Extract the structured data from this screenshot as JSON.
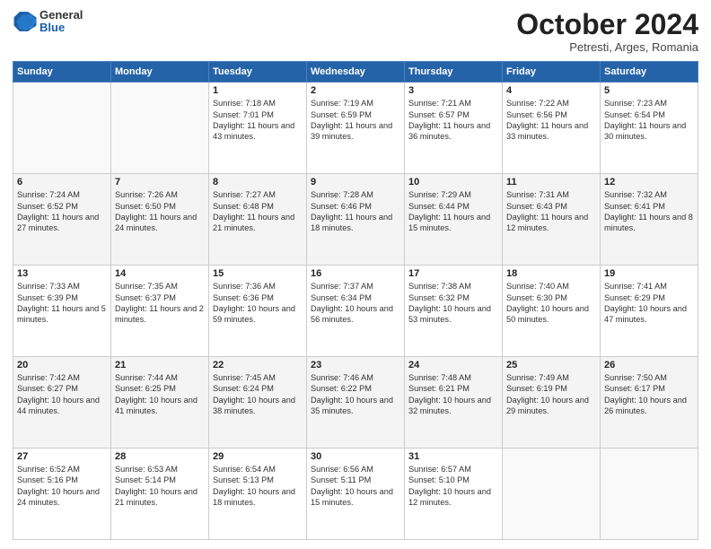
{
  "header": {
    "logo_general": "General",
    "logo_blue": "Blue",
    "month": "October 2024",
    "location": "Petresti, Arges, Romania"
  },
  "days_of_week": [
    "Sunday",
    "Monday",
    "Tuesday",
    "Wednesday",
    "Thursday",
    "Friday",
    "Saturday"
  ],
  "weeks": [
    [
      {
        "day": null,
        "content": ""
      },
      {
        "day": null,
        "content": ""
      },
      {
        "day": "1",
        "content": "Sunrise: 7:18 AM\nSunset: 7:01 PM\nDaylight: 11 hours and 43 minutes."
      },
      {
        "day": "2",
        "content": "Sunrise: 7:19 AM\nSunset: 6:59 PM\nDaylight: 11 hours and 39 minutes."
      },
      {
        "day": "3",
        "content": "Sunrise: 7:21 AM\nSunset: 6:57 PM\nDaylight: 11 hours and 36 minutes."
      },
      {
        "day": "4",
        "content": "Sunrise: 7:22 AM\nSunset: 6:56 PM\nDaylight: 11 hours and 33 minutes."
      },
      {
        "day": "5",
        "content": "Sunrise: 7:23 AM\nSunset: 6:54 PM\nDaylight: 11 hours and 30 minutes."
      }
    ],
    [
      {
        "day": "6",
        "content": "Sunrise: 7:24 AM\nSunset: 6:52 PM\nDaylight: 11 hours and 27 minutes."
      },
      {
        "day": "7",
        "content": "Sunrise: 7:26 AM\nSunset: 6:50 PM\nDaylight: 11 hours and 24 minutes."
      },
      {
        "day": "8",
        "content": "Sunrise: 7:27 AM\nSunset: 6:48 PM\nDaylight: 11 hours and 21 minutes."
      },
      {
        "day": "9",
        "content": "Sunrise: 7:28 AM\nSunset: 6:46 PM\nDaylight: 11 hours and 18 minutes."
      },
      {
        "day": "10",
        "content": "Sunrise: 7:29 AM\nSunset: 6:44 PM\nDaylight: 11 hours and 15 minutes."
      },
      {
        "day": "11",
        "content": "Sunrise: 7:31 AM\nSunset: 6:43 PM\nDaylight: 11 hours and 12 minutes."
      },
      {
        "day": "12",
        "content": "Sunrise: 7:32 AM\nSunset: 6:41 PM\nDaylight: 11 hours and 8 minutes."
      }
    ],
    [
      {
        "day": "13",
        "content": "Sunrise: 7:33 AM\nSunset: 6:39 PM\nDaylight: 11 hours and 5 minutes."
      },
      {
        "day": "14",
        "content": "Sunrise: 7:35 AM\nSunset: 6:37 PM\nDaylight: 11 hours and 2 minutes."
      },
      {
        "day": "15",
        "content": "Sunrise: 7:36 AM\nSunset: 6:36 PM\nDaylight: 10 hours and 59 minutes."
      },
      {
        "day": "16",
        "content": "Sunrise: 7:37 AM\nSunset: 6:34 PM\nDaylight: 10 hours and 56 minutes."
      },
      {
        "day": "17",
        "content": "Sunrise: 7:38 AM\nSunset: 6:32 PM\nDaylight: 10 hours and 53 minutes."
      },
      {
        "day": "18",
        "content": "Sunrise: 7:40 AM\nSunset: 6:30 PM\nDaylight: 10 hours and 50 minutes."
      },
      {
        "day": "19",
        "content": "Sunrise: 7:41 AM\nSunset: 6:29 PM\nDaylight: 10 hours and 47 minutes."
      }
    ],
    [
      {
        "day": "20",
        "content": "Sunrise: 7:42 AM\nSunset: 6:27 PM\nDaylight: 10 hours and 44 minutes."
      },
      {
        "day": "21",
        "content": "Sunrise: 7:44 AM\nSunset: 6:25 PM\nDaylight: 10 hours and 41 minutes."
      },
      {
        "day": "22",
        "content": "Sunrise: 7:45 AM\nSunset: 6:24 PM\nDaylight: 10 hours and 38 minutes."
      },
      {
        "day": "23",
        "content": "Sunrise: 7:46 AM\nSunset: 6:22 PM\nDaylight: 10 hours and 35 minutes."
      },
      {
        "day": "24",
        "content": "Sunrise: 7:48 AM\nSunset: 6:21 PM\nDaylight: 10 hours and 32 minutes."
      },
      {
        "day": "25",
        "content": "Sunrise: 7:49 AM\nSunset: 6:19 PM\nDaylight: 10 hours and 29 minutes."
      },
      {
        "day": "26",
        "content": "Sunrise: 7:50 AM\nSunset: 6:17 PM\nDaylight: 10 hours and 26 minutes."
      }
    ],
    [
      {
        "day": "27",
        "content": "Sunrise: 6:52 AM\nSunset: 5:16 PM\nDaylight: 10 hours and 24 minutes."
      },
      {
        "day": "28",
        "content": "Sunrise: 6:53 AM\nSunset: 5:14 PM\nDaylight: 10 hours and 21 minutes."
      },
      {
        "day": "29",
        "content": "Sunrise: 6:54 AM\nSunset: 5:13 PM\nDaylight: 10 hours and 18 minutes."
      },
      {
        "day": "30",
        "content": "Sunrise: 6:56 AM\nSunset: 5:11 PM\nDaylight: 10 hours and 15 minutes."
      },
      {
        "day": "31",
        "content": "Sunrise: 6:57 AM\nSunset: 5:10 PM\nDaylight: 10 hours and 12 minutes."
      },
      {
        "day": null,
        "content": ""
      },
      {
        "day": null,
        "content": ""
      }
    ]
  ]
}
